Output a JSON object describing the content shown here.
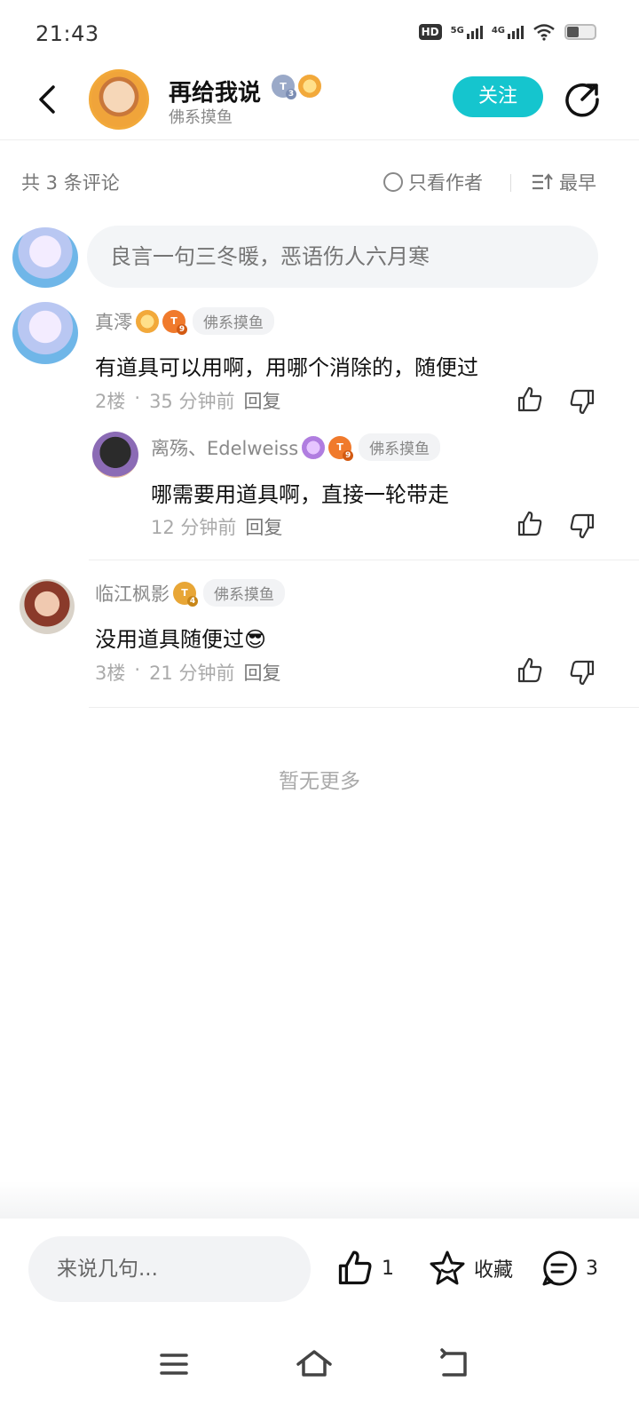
{
  "status": {
    "time": "21:43",
    "hd": "HD",
    "net1": "5G",
    "net2": "4G"
  },
  "header": {
    "author_name": "再给我说",
    "author_sub": "佛系摸鱼",
    "badge_level": "3",
    "follow_label": "关注"
  },
  "comments_header": {
    "count_text": "共 3 条评论",
    "only_author_label": "只看作者",
    "sort_label": "最早"
  },
  "input": {
    "placeholder": "良言一句三冬暖，恶语伤人六月寒"
  },
  "comments": [
    {
      "name": "真澪",
      "level": "9",
      "tag": "佛系摸鱼",
      "text": "有道具可以用啊，用哪个消除的，随便过",
      "floor": "2楼",
      "dot": "·",
      "time": "35 分钟前",
      "reply_label": "回复",
      "replies": [
        {
          "name": "离殇、Edelweiss",
          "level": "9",
          "tag": "佛系摸鱼",
          "text": "哪需要用道具啊，直接一轮带走",
          "time": "12 分钟前",
          "reply_label": "回复"
        }
      ]
    },
    {
      "name": "临江枫影",
      "level": "4",
      "tag": "佛系摸鱼",
      "text": "没用道具随便过",
      "emoji": "😎",
      "floor": "3楼",
      "dot": "·",
      "time": "21 分钟前",
      "reply_label": "回复"
    }
  ],
  "no_more": "暂无更多",
  "bottom": {
    "say_placeholder": "来说几句...",
    "like_count": "1",
    "collect_label": "收藏",
    "comment_count": "3"
  },
  "colors": {
    "accent": "#15c5ce",
    "badge_orange": "#f07a2c",
    "badge_gold": "#e8a636",
    "badge_gray": "#9aa9c8"
  }
}
